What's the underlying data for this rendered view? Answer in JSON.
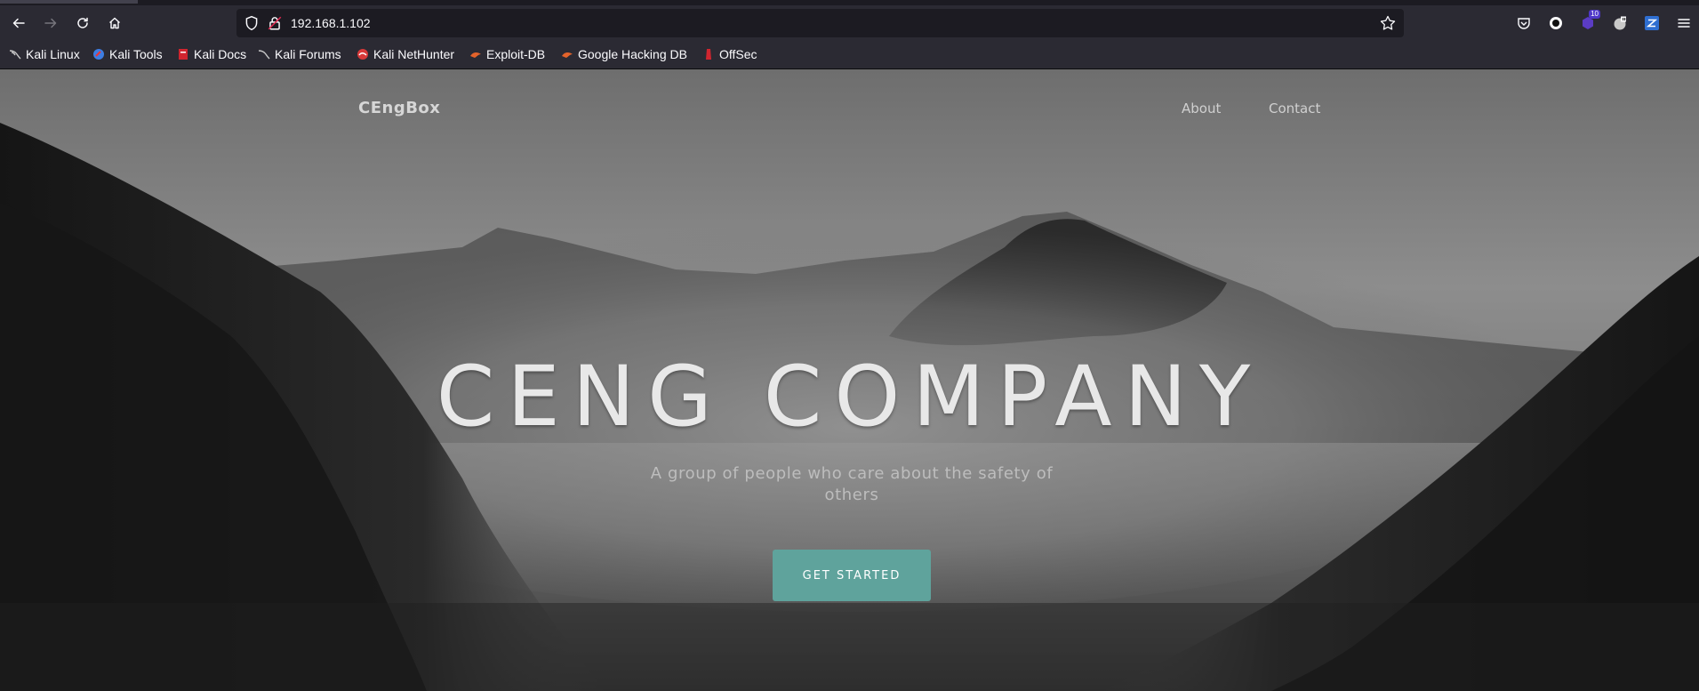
{
  "browser": {
    "url": "192.168.1.102",
    "bookmarks": [
      {
        "label": "Kali Linux",
        "icon": "kali-dragon-icon"
      },
      {
        "label": "Kali Tools",
        "icon": "kali-tools-icon"
      },
      {
        "label": "Kali Docs",
        "icon": "kali-docs-icon"
      },
      {
        "label": "Kali Forums",
        "icon": "kali-forums-icon"
      },
      {
        "label": "Kali NetHunter",
        "icon": "nethunter-icon"
      },
      {
        "label": "Exploit-DB",
        "icon": "exploit-db-icon"
      },
      {
        "label": "Google Hacking DB",
        "icon": "ghdb-icon"
      },
      {
        "label": "OffSec",
        "icon": "offsec-icon"
      }
    ],
    "extensions": {
      "badge_count": "10"
    }
  },
  "site": {
    "brand": "CEngBox",
    "nav": {
      "about": "About",
      "contact": "Contact"
    },
    "hero": {
      "title": "CENG COMPANY",
      "subtitle": "A group of people who care about the safety of others",
      "cta": "GET STARTED"
    }
  },
  "colors": {
    "chrome_bg": "#2b2a33",
    "urlbar_bg": "#1c1b22",
    "cta_bg": "#5fa39c"
  }
}
